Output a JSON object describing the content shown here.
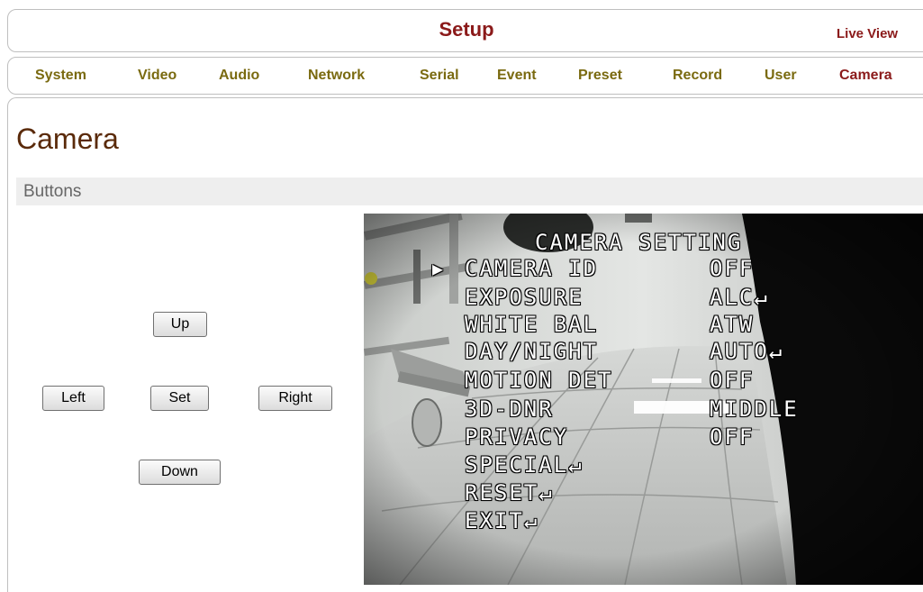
{
  "header": {
    "title": "Setup",
    "live_view": "Live View"
  },
  "nav": {
    "tabs": [
      {
        "label": "System",
        "active": false
      },
      {
        "label": "Video",
        "active": false
      },
      {
        "label": "Audio",
        "active": false
      },
      {
        "label": "Network",
        "active": false
      },
      {
        "label": "Serial",
        "active": false
      },
      {
        "label": "Event",
        "active": false
      },
      {
        "label": "Preset",
        "active": false
      },
      {
        "label": "Record",
        "active": false
      },
      {
        "label": "User",
        "active": false
      },
      {
        "label": "Camera",
        "active": true
      }
    ]
  },
  "page": {
    "title": "Camera",
    "section": "Buttons"
  },
  "controls": {
    "up": "Up",
    "left": "Left",
    "set": "Set",
    "right": "Right",
    "down": "Down"
  },
  "osd": {
    "title": "CAMERA SETTING",
    "cursor": "▶",
    "rows": [
      {
        "label": "CAMERA ID",
        "value": "OFF"
      },
      {
        "label": "EXPOSURE",
        "value": "ALC↵"
      },
      {
        "label": "WHITE BAL",
        "value": "ATW"
      },
      {
        "label": "DAY/NIGHT",
        "value": "AUTO↵"
      },
      {
        "label": "MOTION DET",
        "value": "OFF"
      },
      {
        "label": "3D-DNR",
        "value": "MIDDLE"
      },
      {
        "label": "PRIVACY",
        "value": "OFF"
      },
      {
        "label": "SPECIAL↵",
        "value": ""
      },
      {
        "label": "RESET↵",
        "value": ""
      },
      {
        "label": "EXIT↵",
        "value": ""
      }
    ]
  },
  "colors": {
    "accent": "#8b1a1a",
    "tab": "#7a6a10",
    "title": "#5a2a0a",
    "section_bg": "#eeeeee"
  }
}
